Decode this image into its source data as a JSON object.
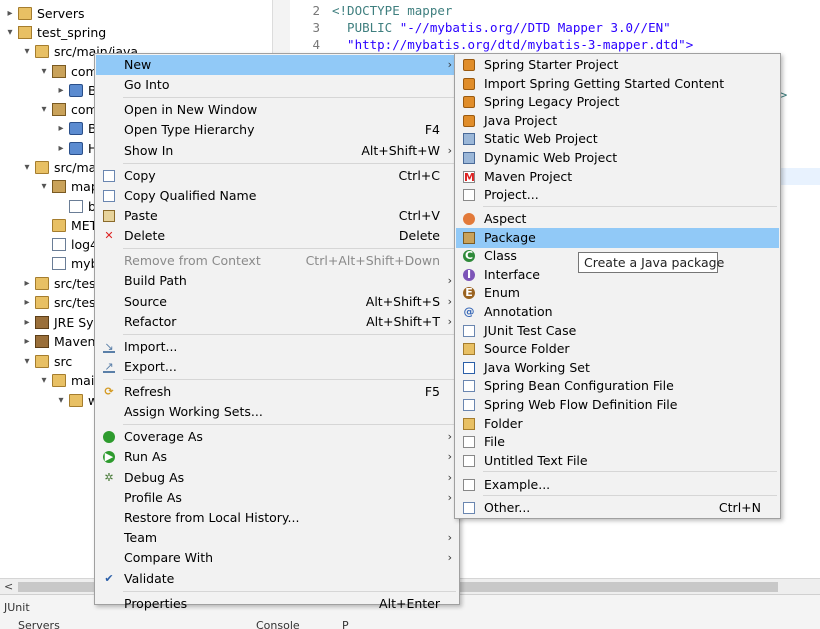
{
  "explorer": {
    "rows": [
      {
        "label": "Servers",
        "icon": "folder-icon"
      },
      {
        "label": "test_spring",
        "icon": "project-icon"
      },
      {
        "label": "src/main/java",
        "icon": "source-folder-icon"
      },
      {
        "label": "com",
        "icon": "package-icon"
      },
      {
        "label": "B",
        "icon": "java-file-icon"
      },
      {
        "label": "com",
        "icon": "package-icon"
      },
      {
        "label": "B",
        "icon": "java-file-icon"
      },
      {
        "label": "H",
        "icon": "java-file-icon"
      },
      {
        "label": "src/mai",
        "icon": "source-folder-icon"
      },
      {
        "label": "map",
        "icon": "package-icon"
      },
      {
        "label": "b",
        "icon": "xml-file-icon"
      },
      {
        "label": "MET",
        "icon": "folder-icon"
      },
      {
        "label": "log4",
        "icon": "xml-file-icon"
      },
      {
        "label": "myb",
        "icon": "xml-file-icon"
      },
      {
        "label": "src/test",
        "icon": "source-folder-icon"
      },
      {
        "label": "src/test",
        "icon": "source-folder-icon"
      },
      {
        "label": "JRE Sys",
        "icon": "library-icon"
      },
      {
        "label": "Maven",
        "icon": "library-icon"
      },
      {
        "label": "src",
        "icon": "folder-icon"
      },
      {
        "label": "main",
        "icon": "folder-icon"
      },
      {
        "label": "w",
        "icon": "folder-icon"
      }
    ]
  },
  "editor": {
    "lines": [
      {
        "num": "2",
        "parts": [
          {
            "t": "<!DOCTYPE mapper",
            "c": "kw"
          }
        ]
      },
      {
        "num": "3",
        "parts": [
          {
            "t": "  PUBLIC ",
            "c": "kw"
          },
          {
            "t": "\"-//mybatis.org//DTD Mapper 3.0//EN\"",
            "c": "str"
          }
        ]
      },
      {
        "num": "4",
        "parts": [
          {
            "t": "  \"http://mybatis.org/dtd/mybatis-3-mapper.dtd\">",
            "c": "str"
          }
        ]
      }
    ]
  },
  "context_menu": {
    "items": [
      {
        "label": "New",
        "shortcut": "",
        "arrow": true,
        "selected": true
      },
      {
        "label": "Go Into",
        "shortcut": ""
      },
      {
        "sep": true
      },
      {
        "label": "Open in New Window",
        "shortcut": ""
      },
      {
        "label": "Open Type Hierarchy",
        "shortcut": "F4"
      },
      {
        "label": "Show In",
        "shortcut": "Alt+Shift+W",
        "arrow": true
      },
      {
        "sep": true
      },
      {
        "label": "Copy",
        "shortcut": "Ctrl+C",
        "icon": "copy-icon"
      },
      {
        "label": "Copy Qualified Name",
        "shortcut": "",
        "icon": "copy-icon"
      },
      {
        "label": "Paste",
        "shortcut": "Ctrl+V",
        "icon": "paste-icon"
      },
      {
        "label": "Delete",
        "shortcut": "Delete",
        "icon": "delete-icon"
      },
      {
        "sep": true
      },
      {
        "label": "Remove from Context",
        "shortcut": "Ctrl+Alt+Shift+Down",
        "disabled": true
      },
      {
        "label": "Build Path",
        "shortcut": "",
        "arrow": true
      },
      {
        "label": "Source",
        "shortcut": "Alt+Shift+S",
        "arrow": true
      },
      {
        "label": "Refactor",
        "shortcut": "Alt+Shift+T",
        "arrow": true
      },
      {
        "sep": true
      },
      {
        "label": "Import...",
        "shortcut": "",
        "icon": "import-icon"
      },
      {
        "label": "Export...",
        "shortcut": "",
        "icon": "export-icon"
      },
      {
        "sep": true
      },
      {
        "label": "Refresh",
        "shortcut": "F5",
        "icon": "refresh-icon"
      },
      {
        "label": "Assign Working Sets...",
        "shortcut": ""
      },
      {
        "sep": true
      },
      {
        "label": "Coverage As",
        "shortcut": "",
        "arrow": true,
        "icon": "coverage-icon"
      },
      {
        "label": "Run As",
        "shortcut": "",
        "arrow": true,
        "icon": "run-icon"
      },
      {
        "label": "Debug As",
        "shortcut": "",
        "arrow": true,
        "icon": "debug-icon"
      },
      {
        "label": "Profile As",
        "shortcut": "",
        "arrow": true
      },
      {
        "label": "Restore from Local History...",
        "shortcut": ""
      },
      {
        "label": "Team",
        "shortcut": "",
        "arrow": true
      },
      {
        "label": "Compare With",
        "shortcut": "",
        "arrow": true
      },
      {
        "label": "Validate",
        "shortcut": "",
        "icon": "check-icon"
      },
      {
        "sep": true
      },
      {
        "label": "Properties",
        "shortcut": "Alt+Enter"
      }
    ]
  },
  "submenu": {
    "items": [
      {
        "label": "Spring Starter Project",
        "icon": "spring-project-icon"
      },
      {
        "label": "Import Spring Getting Started Content",
        "icon": "spring-project-icon"
      },
      {
        "label": "Spring Legacy Project",
        "icon": "spring-project-icon"
      },
      {
        "label": "Java Project",
        "icon": "spring-project-icon"
      },
      {
        "label": "Static Web Project",
        "icon": "web-project-icon"
      },
      {
        "label": "Dynamic Web Project",
        "icon": "web-project-icon"
      },
      {
        "label": "Maven Project",
        "icon": "maven-icon"
      },
      {
        "label": "Project...",
        "icon": "project-icon"
      },
      {
        "sep": true
      },
      {
        "label": "Aspect",
        "icon": "aspect-icon"
      },
      {
        "label": "Package",
        "icon": "package-icon",
        "selected": true
      },
      {
        "label": "Class",
        "icon": "class-icon"
      },
      {
        "label": "Interface",
        "icon": "interface-icon"
      },
      {
        "label": "Enum",
        "icon": "enum-icon"
      },
      {
        "label": "Annotation",
        "icon": "annotation-icon"
      },
      {
        "label": "JUnit Test Case",
        "icon": "junit-icon"
      },
      {
        "label": "Source Folder",
        "icon": "source-folder-icon"
      },
      {
        "label": "Java Working Set",
        "icon": "working-set-icon"
      },
      {
        "label": "Spring Bean Configuration File",
        "icon": "bean-file-icon"
      },
      {
        "label": "Spring Web Flow Definition File",
        "icon": "bean-file-icon"
      },
      {
        "label": "Folder",
        "icon": "folder-icon"
      },
      {
        "label": "File",
        "icon": "file-icon"
      },
      {
        "label": "Untitled Text File",
        "icon": "text-file-icon"
      },
      {
        "sep": true
      },
      {
        "label": "Example...",
        "icon": "example-icon"
      },
      {
        "sep": true
      },
      {
        "label": "Other...",
        "shortcut": "Ctrl+N",
        "icon": "other-icon"
      }
    ]
  },
  "tooltip": {
    "text": "Create a Java package"
  },
  "bottom_tabs": [
    "JUnit",
    "Servers",
    "Console",
    "P"
  ]
}
